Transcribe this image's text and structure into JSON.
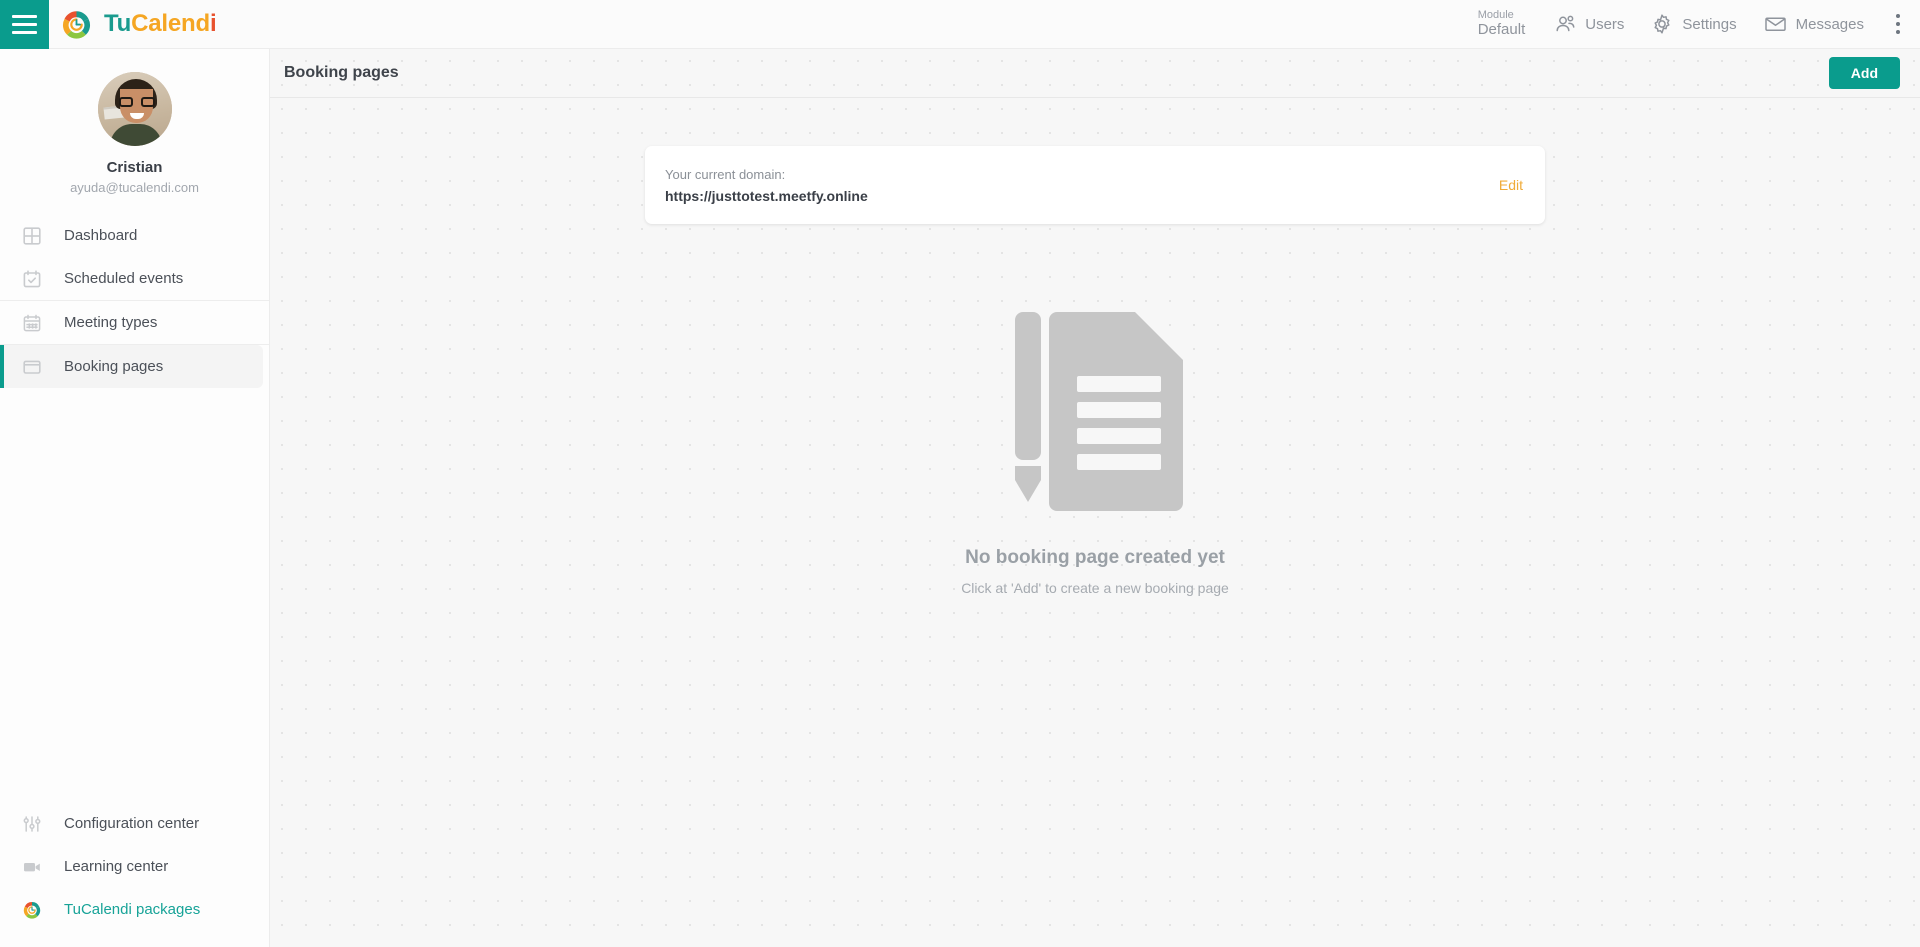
{
  "topbar": {
    "menu_icon": "hamburger-icon",
    "brand": {
      "part1": "Tu",
      "part2": "Calend",
      "part3": "i",
      "logo_icon": "tucalendi-logo-icon"
    },
    "module": {
      "label": "Module",
      "value": "Default"
    },
    "nav": [
      {
        "label": "Users",
        "icon": "users-icon"
      },
      {
        "label": "Settings",
        "icon": "gear-icon"
      },
      {
        "label": "Messages",
        "icon": "envelope-icon"
      }
    ],
    "overflow_icon": "kebab-menu-icon"
  },
  "sidebar": {
    "profile": {
      "name": "Cristian",
      "email": "ayuda@tucalendi.com",
      "avatar_icon": "user-avatar"
    },
    "groups": [
      {
        "items": [
          {
            "label": "Dashboard",
            "icon": "dashboard-grid-icon",
            "active": false
          },
          {
            "label": "Scheduled events",
            "icon": "calendar-check-icon",
            "active": false
          }
        ]
      },
      {
        "items": [
          {
            "label": "Meeting types",
            "icon": "calendar-grid-icon",
            "active": false
          }
        ]
      },
      {
        "items": [
          {
            "label": "Booking pages",
            "icon": "browser-window-icon",
            "active": true
          }
        ]
      }
    ],
    "bottom": [
      {
        "label": "Configuration center",
        "icon": "sliders-icon",
        "highlight": false
      },
      {
        "label": "Learning center",
        "icon": "video-camera-icon",
        "highlight": false
      },
      {
        "label": "TuCalendi packages",
        "icon": "tucalendi-logo-icon",
        "highlight": true
      }
    ]
  },
  "main": {
    "title": "Booking pages",
    "add_label": "Add",
    "domain_card": {
      "label": "Your current domain:",
      "url": "https://justtotest.meetfy.online",
      "edit_label": "Edit"
    },
    "empty_state": {
      "illustration_icon": "document-pencil-icon",
      "title": "No booking page created yet",
      "subtitle": "Click at 'Add' to create a new booking page"
    }
  },
  "colors": {
    "accent_teal": "#0a9c8d",
    "brand_orange": "#f5a623",
    "brand_red": "#e8522e",
    "edit_link": "#f0ab38",
    "page_bg": "#f7f7f7"
  }
}
